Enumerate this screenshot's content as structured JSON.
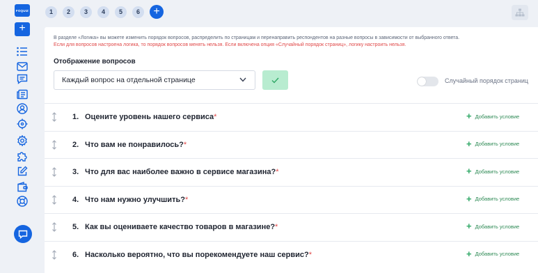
{
  "brand": {
    "logo_text": "FOQUIZ",
    "accent": "#1565e0"
  },
  "sidebar": {
    "add_label": "+",
    "icons": [
      "list-icon",
      "mail-icon",
      "comment-icon",
      "newspaper-icon",
      "user-icon",
      "target-icon",
      "gear-icon",
      "puzzle-icon",
      "edit-icon",
      "wallet-icon",
      "lifebuoy-icon"
    ],
    "chat_icon": "chat-icon"
  },
  "tabs": {
    "pages": [
      "1",
      "2",
      "3",
      "4",
      "5",
      "6"
    ],
    "add_label": "+"
  },
  "info": {
    "line1": "В разделе «Логика» вы можете изменить порядок вопросов, распределить по страницам и перенаправить респондентов на разные вопросы в зависимости от выбранного ответа.",
    "line2": "Если для вопросов настроена логика, то порядок вопросов менять нельзя. Если включена опция «Случайный порядок страниц», логику настроить нельзя."
  },
  "display": {
    "title": "Отображение вопросов",
    "select_value": "Каждый вопрос на отдельной странице",
    "random_pages_label": "Случайный порядок страниц",
    "random_pages_on": false
  },
  "questions": [
    {
      "num": "1.",
      "text": "Оцените уровень нашего сервиса",
      "req": "*",
      "cond": "Добавить условие"
    },
    {
      "num": "2.",
      "text": "Что вам не понравилось?",
      "req": "*",
      "cond": "Добавить условие"
    },
    {
      "num": "3.",
      "text": "Что для вас наиболее важно в сервисе магазина?",
      "req": "*",
      "cond": "Добавить условие"
    },
    {
      "num": "4.",
      "text": "Что нам нужно улучшить?",
      "req": "*",
      "cond": "Добавить условие"
    },
    {
      "num": "5.",
      "text": "Как вы оцениваете качество товаров в магазине?",
      "req": "*",
      "cond": "Добавить условие"
    },
    {
      "num": "6.",
      "text": "Насколько вероятно, что вы порекомендуете наш сервис?",
      "req": "*",
      "cond": "Добавить условие"
    }
  ]
}
